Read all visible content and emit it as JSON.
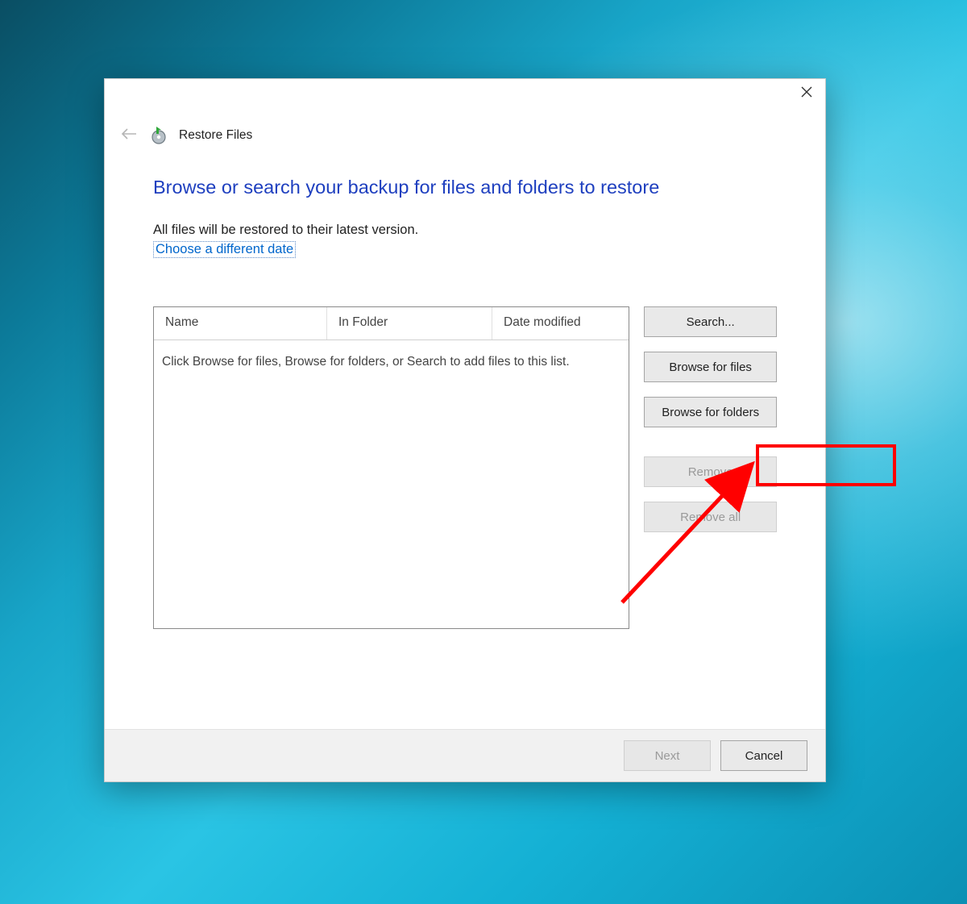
{
  "window": {
    "title": "Restore Files"
  },
  "main": {
    "heading": "Browse or search your backup for files and folders to restore",
    "description": "All files will be restored to their latest version.",
    "date_link": "Choose a different date"
  },
  "list": {
    "columns": {
      "name": "Name",
      "folder": "In Folder",
      "modified": "Date modified"
    },
    "empty_text": "Click Browse for files, Browse for folders, or Search to add files to this list."
  },
  "buttons": {
    "search": "Search...",
    "browse_files": "Browse for files",
    "browse_folders": "Browse for folders",
    "remove": "Remove",
    "remove_all": "Remove all",
    "next": "Next",
    "cancel": "Cancel"
  },
  "annotation": {
    "highlighted_button": "browse_files"
  }
}
